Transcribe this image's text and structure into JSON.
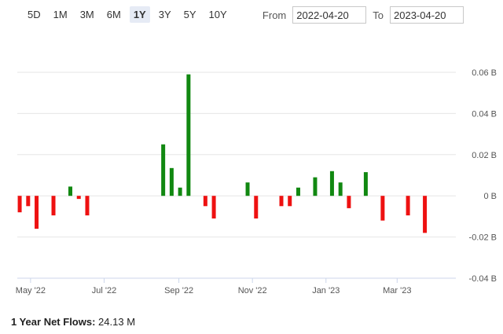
{
  "range_buttons": [
    {
      "label": "5D",
      "active": false
    },
    {
      "label": "1M",
      "active": false
    },
    {
      "label": "3M",
      "active": false
    },
    {
      "label": "6M",
      "active": false
    },
    {
      "label": "1Y",
      "active": true
    },
    {
      "label": "3Y",
      "active": false
    },
    {
      "label": "5Y",
      "active": false
    },
    {
      "label": "10Y",
      "active": false
    }
  ],
  "date_range": {
    "from_label": "From",
    "from_value": "2022-04-20",
    "to_label": "To",
    "to_value": "2023-04-20"
  },
  "footer": {
    "label": "1 Year Net Flows:",
    "value": "24.13 M"
  },
  "colors": {
    "positive": "#118811",
    "negative": "#ee1111",
    "grid": "#e6e6e6",
    "axis": "#ccd6eb"
  },
  "chart_data": {
    "type": "bar",
    "x_tick_labels": [
      "May '22",
      "Jul '22",
      "Sep '22",
      "Nov '22",
      "Jan '23",
      "Mar '23"
    ],
    "x_tick_dates": [
      "2022-05-01",
      "2022-07-01",
      "2022-09-01",
      "2022-11-01",
      "2023-01-01",
      "2023-03-01"
    ],
    "x_range": [
      "2022-04-20",
      "2023-04-20"
    ],
    "y_tick_labels": [
      "0.06 B",
      "0.04 B",
      "0.02 B",
      "0 B",
      "-0.02 B",
      "-0.04 B"
    ],
    "y_ticks": [
      0.06,
      0.04,
      0.02,
      0,
      -0.02,
      -0.04
    ],
    "ylim": [
      -0.04,
      0.06
    ],
    "grid": true,
    "series": [
      {
        "points": [
          {
            "date": "2022-04-22",
            "value": -0.008
          },
          {
            "date": "2022-04-29",
            "value": -0.005
          },
          {
            "date": "2022-05-06",
            "value": -0.016
          },
          {
            "date": "2022-05-20",
            "value": -0.0095
          },
          {
            "date": "2022-06-03",
            "value": 0.0045
          },
          {
            "date": "2022-06-10",
            "value": -0.0015
          },
          {
            "date": "2022-06-17",
            "value": -0.0095
          },
          {
            "date": "2022-08-19",
            "value": 0.025
          },
          {
            "date": "2022-08-26",
            "value": 0.0135
          },
          {
            "date": "2022-09-02",
            "value": 0.004
          },
          {
            "date": "2022-09-09",
            "value": 0.059
          },
          {
            "date": "2022-09-23",
            "value": -0.005
          },
          {
            "date": "2022-09-30",
            "value": -0.011
          },
          {
            "date": "2022-10-28",
            "value": 0.0065
          },
          {
            "date": "2022-11-04",
            "value": -0.011
          },
          {
            "date": "2022-11-25",
            "value": -0.005
          },
          {
            "date": "2022-12-02",
            "value": -0.005
          },
          {
            "date": "2022-12-09",
            "value": 0.004
          },
          {
            "date": "2022-12-23",
            "value": 0.009
          },
          {
            "date": "2023-01-06",
            "value": 0.012
          },
          {
            "date": "2023-01-13",
            "value": 0.0065
          },
          {
            "date": "2023-01-20",
            "value": -0.006
          },
          {
            "date": "2023-02-03",
            "value": 0.0115
          },
          {
            "date": "2023-02-17",
            "value": -0.012
          },
          {
            "date": "2023-03-10",
            "value": -0.0095
          },
          {
            "date": "2023-03-24",
            "value": -0.018
          }
        ]
      }
    ]
  }
}
